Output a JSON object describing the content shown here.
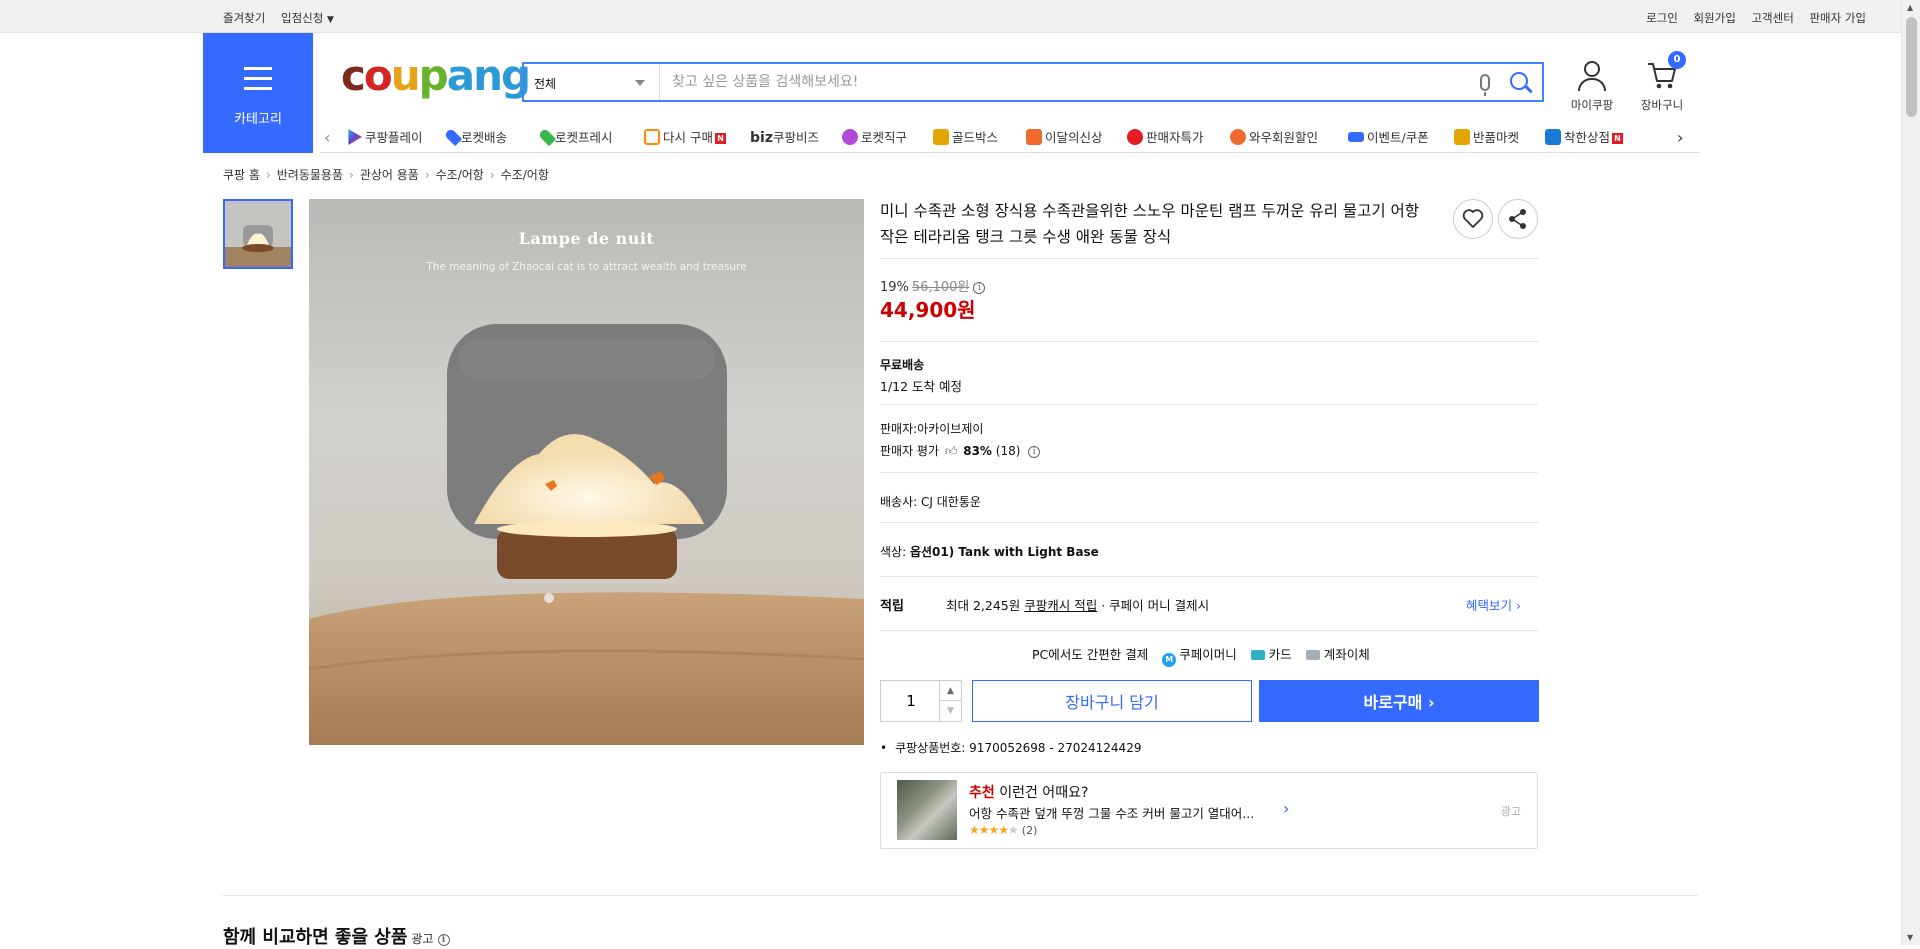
{
  "topbar": {
    "left": [
      "즐겨찾기",
      "입점신청"
    ],
    "right": [
      "로그인",
      "회원가입",
      "고객센터",
      "판매자 가입"
    ]
  },
  "header": {
    "category_label": "카테고리",
    "search": {
      "category_value": "전체",
      "placeholder": "찾고 싶은 상품을 검색해보세요!"
    },
    "mycoupang_label": "마이쿠팡",
    "cart_label": "장바구니",
    "cart_count": "0"
  },
  "nav": [
    {
      "label": "쿠팡플레이",
      "icon": "play-icon",
      "color": "#5b46c9"
    },
    {
      "label": "로켓배송",
      "icon": "rocket-icon",
      "color": "#346aff"
    },
    {
      "label": "로켓프레시",
      "icon": "rocket-fresh-icon",
      "color": "#3bb54a"
    },
    {
      "label": "다시 구매",
      "icon": "rebuy-icon",
      "color": "#ff8a00",
      "badge": "N"
    },
    {
      "label": "쿠팡비즈",
      "icon": "biz-icon",
      "color": "#333333",
      "prefix": "biz"
    },
    {
      "label": "로켓직구",
      "icon": "global-icon",
      "color": "#b04ad6"
    },
    {
      "label": "골드박스",
      "icon": "goldbox-icon",
      "color": "#e3a500"
    },
    {
      "label": "이달의신상",
      "icon": "new-icon",
      "color": "#f06a2e"
    },
    {
      "label": "판매자특가",
      "icon": "percent-icon",
      "color": "#e31b23"
    },
    {
      "label": "와우회원할인",
      "icon": "wow-icon",
      "color": "#f06a2e"
    },
    {
      "label": "이벤트/쿠폰",
      "icon": "coupon-icon",
      "color": "#346aff"
    },
    {
      "label": "반품마켓",
      "icon": "market-icon",
      "color": "#e3a500"
    },
    {
      "label": "착한상점",
      "icon": "shop-icon",
      "color": "#1b7ad6",
      "badge": "N"
    }
  ],
  "breadcrumb": [
    "쿠팡 홈",
    "반려동물용품",
    "관상어 용품",
    "수조/어항",
    "수조/어항"
  ],
  "image": {
    "title": "Lampe de nuit",
    "subtitle": "The meaning of Zhaocai cat is to attract wealth and treasure"
  },
  "product": {
    "title": "미니 수족관 소형 장식용 수족관을위한 스노우 마운틴 램프 두꺼운 유리 물고기 어항 작은 테라리움 탱크 그릇 수생 애완 동물 장식",
    "discount_rate": "19%",
    "original_price": "56,100원",
    "price": "44,900원",
    "shipping_type": "무료배송",
    "arrival": "1/12 도착 예정",
    "seller": "판매자:아카이브제이",
    "seller_rating_label": "판매자 평가",
    "seller_rating": "83%",
    "seller_rating_count": "(18)",
    "courier_label": "배송사:",
    "courier": "CJ 대한통운",
    "color_label": "색상:",
    "color_value": "옵션01) Tank with Light Base",
    "points_label": "적립",
    "points_prefix": "최대 2,245원",
    "points_link": "쿠팡캐시 적립",
    "points_suffix": "· 쿠페이 머니 결제시",
    "benefit_link": "혜택보기",
    "pay_label": "PC에서도 간편한 결제",
    "pay_methods": [
      "쿠페이머니",
      "카드",
      "계좌이체"
    ],
    "quantity": "1",
    "add_to_cart": "장바구니 담기",
    "buy_now": "바로구매",
    "product_number": "쿠팡상품번호: 9170052698 - 27024124429"
  },
  "recommendation": {
    "highlight": "추천",
    "heading": "이런건 어때요?",
    "description": "어항 수족관 덮개 뚜껑 그물 수조 커버 물고기 열대어...",
    "rating": 4,
    "review_count": "(2)",
    "ad_label": "광고"
  },
  "compare": {
    "title": "함께 비교하면 좋을 상품",
    "ad_label": "광고"
  }
}
